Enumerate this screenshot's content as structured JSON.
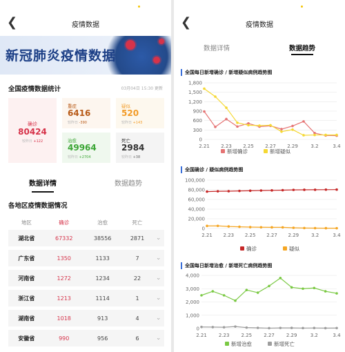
{
  "left": {
    "title": "疫情数据",
    "banner_text": "新冠肺炎疫情数据",
    "stats_heading": "全国疫情数据统计",
    "updated": "03月04日 15:30 更新",
    "confirmed": {
      "label": "确诊",
      "value": "80424",
      "sub_label": "较昨日",
      "delta": "+122"
    },
    "severe": {
      "label": "重症",
      "value": "6416",
      "sub_label": "较昨日",
      "delta": "-390"
    },
    "suspected": {
      "label": "疑似",
      "value": "520",
      "sub_label": "较昨日",
      "delta": "+143"
    },
    "cured": {
      "label": "治愈",
      "value": "49964",
      "sub_label": "较昨日",
      "delta": "+2704"
    },
    "dead": {
      "label": "死亡",
      "value": "2984",
      "sub_label": "较昨日",
      "delta": "+38"
    },
    "tabs": [
      "数据详情",
      "数据趋势"
    ],
    "region_heading": "各地区疫情数据情况",
    "columns": [
      "地区",
      "确诊",
      "治愈",
      "死亡"
    ],
    "rows": [
      {
        "region": "湖北省",
        "confirmed": "67332",
        "cured": "38556",
        "dead": "2871"
      },
      {
        "region": "广东省",
        "confirmed": "1350",
        "cured": "1133",
        "dead": "7"
      },
      {
        "region": "河南省",
        "confirmed": "1272",
        "cured": "1234",
        "dead": "22"
      },
      {
        "region": "浙江省",
        "confirmed": "1213",
        "cured": "1114",
        "dead": "1"
      },
      {
        "region": "湖南省",
        "confirmed": "1018",
        "cured": "913",
        "dead": "4"
      },
      {
        "region": "安徽省",
        "confirmed": "990",
        "cured": "956",
        "dead": "6"
      }
    ]
  },
  "right": {
    "title": "疫情数据",
    "tabs": [
      "数据详情",
      "数据趋势"
    ]
  },
  "colors": {
    "red": "#d6334a",
    "orange": "#f29b27",
    "green": "#3aa534",
    "accent": "#3a6fd8",
    "chart_red": "#e57373",
    "chart_yellow": "#f5d833",
    "chart_darkred": "#c62828",
    "chart_orange": "#f5a623",
    "chart_green": "#7ac943",
    "chart_grey": "#9e9e9e"
  },
  "chart_data": [
    {
      "type": "line",
      "title": "全国每日新增确诊 / 新增疑似病例趋势图",
      "x": [
        "2.21",
        "2.22",
        "2.23",
        "2.24",
        "2.25",
        "2.26",
        "2.27",
        "2.28",
        "2.29",
        "3.1",
        "3.2",
        "3.3",
        "3.4"
      ],
      "xticks": [
        "2.21",
        "2.23",
        "2.25",
        "2.27",
        "2.29",
        "3.2",
        "3.4"
      ],
      "ylim": [
        0,
        1800
      ],
      "yticks": [
        0,
        300,
        600,
        900,
        1200,
        1500,
        1800
      ],
      "ytick_labels": [
        "0",
        "300",
        "600",
        "900",
        "1,200",
        "1,500",
        "1,800"
      ],
      "series": [
        {
          "name": "新增确诊",
          "values": [
            889,
            397,
            648,
            409,
            508,
            406,
            433,
            327,
            427,
            573,
            202,
            125,
            119
          ]
        },
        {
          "name": "新增疑似",
          "values": [
            1614,
            1361,
            1008,
            530,
            452,
            439,
            452,
            248,
            312,
            132,
            141,
            143,
            143
          ]
        }
      ]
    },
    {
      "type": "line",
      "title": "全国确诊 / 疑似病例趋势图",
      "x": [
        "2.21",
        "2.22",
        "2.23",
        "2.24",
        "2.25",
        "2.26",
        "2.27",
        "2.28",
        "2.29",
        "3.1",
        "3.2",
        "3.3",
        "3.4"
      ],
      "xticks": [
        "2.21",
        "2.23",
        "2.25",
        "2.27",
        "2.29",
        "3.2",
        "3.4"
      ],
      "ylim": [
        0,
        100000
      ],
      "yticks": [
        0,
        20000,
        40000,
        60000,
        80000,
        100000
      ],
      "ytick_labels": [
        "0",
        "20,000",
        "40,000",
        "60,000",
        "80,000",
        "100,000"
      ],
      "series": [
        {
          "name": "确诊",
          "values": [
            76288,
            76936,
            77150,
            77658,
            78064,
            78497,
            78824,
            79251,
            79824,
            80026,
            80151,
            80270,
            80424
          ]
        },
        {
          "name": "疑似",
          "values": [
            5206,
            5365,
            4148,
            3434,
            2824,
            2491,
            2358,
            2308,
            1418,
            851,
            715,
            587,
            520
          ]
        }
      ]
    },
    {
      "type": "line",
      "title": "全国每日新增治愈 / 新增死亡病例趋势图",
      "x": [
        "2.21",
        "2.22",
        "2.23",
        "2.24",
        "2.25",
        "2.26",
        "2.27",
        "2.28",
        "2.29",
        "3.1",
        "3.2",
        "3.3",
        "3.4"
      ],
      "xticks": [
        "2.21",
        "2.23",
        "2.25",
        "2.27",
        "2.29",
        "3.2",
        "3.4"
      ],
      "ylim": [
        0,
        4000
      ],
      "yticks": [
        0,
        1000,
        2000,
        3000,
        4000
      ],
      "ytick_labels": [
        "0",
        "1,000",
        "2,000",
        "3,000",
        "4,000"
      ],
      "series": [
        {
          "name": "新增治愈",
          "values": [
            2500,
            2800,
            2500,
            2100,
            2900,
            2700,
            3200,
            3800,
            3100,
            3000,
            3050,
            2800,
            2650
          ]
        },
        {
          "name": "新增死亡",
          "values": [
            118,
            109,
            97,
            150,
            71,
            52,
            29,
            44,
            47,
            35,
            42,
            31,
            38
          ]
        }
      ]
    }
  ]
}
